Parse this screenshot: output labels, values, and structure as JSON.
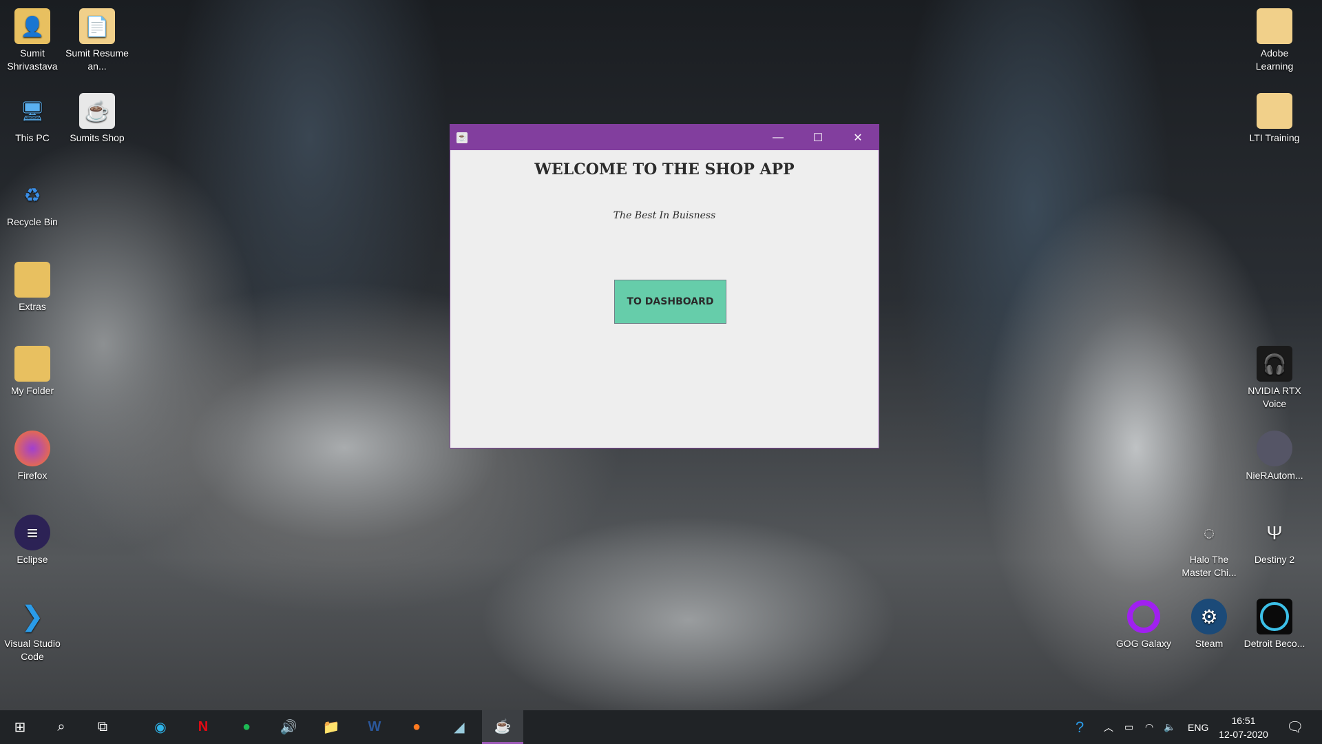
{
  "desktop_icons": [
    {
      "label": "Sumit Shrivastava",
      "icon": "user-folder-icon"
    },
    {
      "label": "Sumit Resume an...",
      "icon": "pdf-folder-icon"
    },
    {
      "label": "This PC",
      "icon": "computer-icon"
    },
    {
      "label": "Sumits Shop",
      "icon": "java-icon"
    },
    {
      "label": "Recycle Bin",
      "icon": "recycle-bin-icon"
    },
    {
      "label": "Extras",
      "icon": "folder-icon"
    },
    {
      "label": "My Folder",
      "icon": "folder-icon"
    },
    {
      "label": "Firefox",
      "icon": "firefox-icon"
    },
    {
      "label": "Eclipse",
      "icon": "eclipse-icon"
    },
    {
      "label": "Visual Studio Code",
      "icon": "vscode-icon"
    },
    {
      "label": "Adobe Learning",
      "icon": "folder-icon"
    },
    {
      "label": "LTI Training",
      "icon": "folder-icon"
    },
    {
      "label": "NVIDIA RTX Voice",
      "icon": "nvidia-icon"
    },
    {
      "label": "NieRAutom...",
      "icon": "game-icon"
    },
    {
      "label": "Halo The Master Chi...",
      "icon": "halo-icon"
    },
    {
      "label": "Destiny 2",
      "icon": "destiny-icon"
    },
    {
      "label": "GOG Galaxy",
      "icon": "gog-icon"
    },
    {
      "label": "Steam",
      "icon": "steam-icon"
    },
    {
      "label": "Detroit Beco...",
      "icon": "detroit-icon"
    }
  ],
  "window": {
    "heading": "WELCOME TO THE SHOP APP",
    "tagline": "The Best In Buisness",
    "button": "TO DASHBOARD",
    "accent": "#823e9e",
    "button_color": "#66cdaa"
  },
  "tray": {
    "lang": "ENG",
    "time": "16:51",
    "date": "12-07-2020"
  }
}
